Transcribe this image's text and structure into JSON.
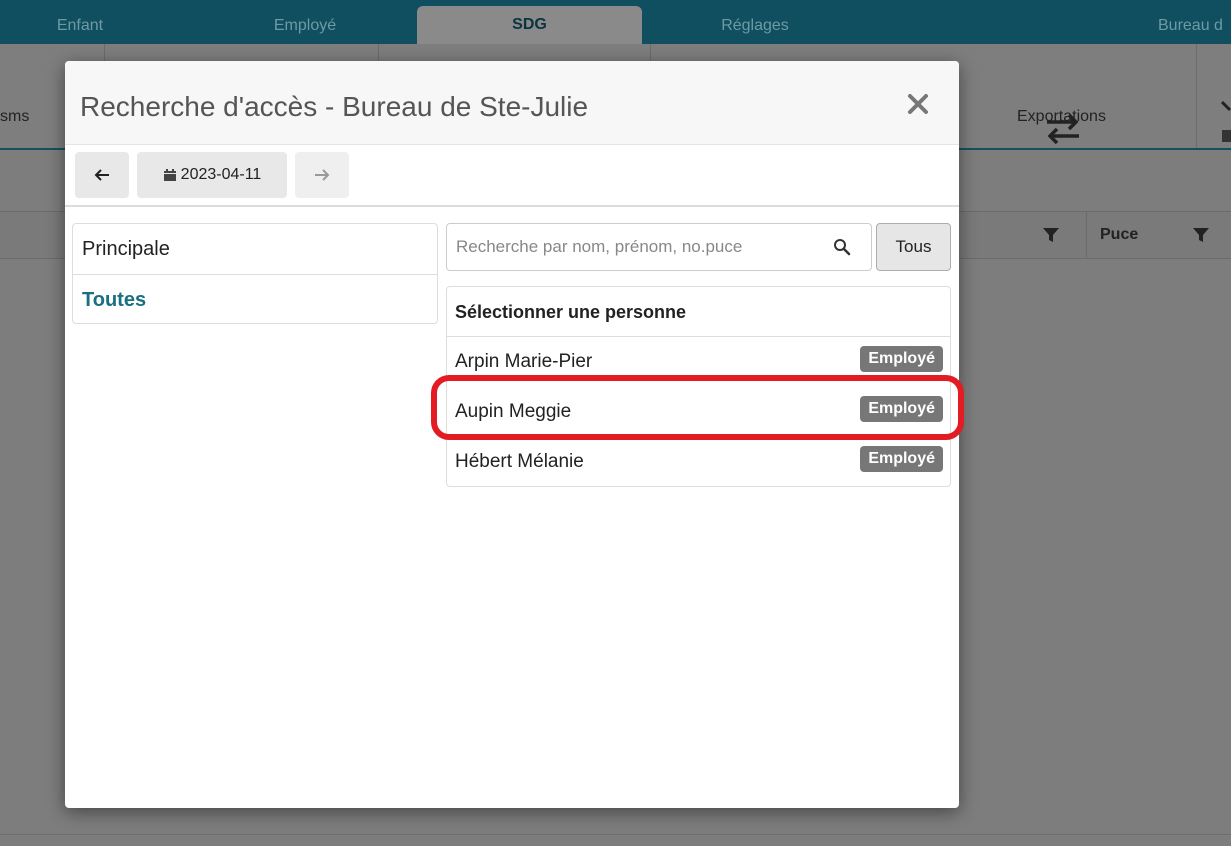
{
  "topnav": {
    "tabs": [
      {
        "label": "Enfant"
      },
      {
        "label": "Employé"
      },
      {
        "label": "SDG"
      },
      {
        "label": "Réglages"
      },
      {
        "label": "Bureau d"
      }
    ]
  },
  "toolbar": {
    "partial_label": "sms",
    "exportations_label": "Exportations"
  },
  "grid": {
    "puce_header": "Puce"
  },
  "modal": {
    "title": "Recherche d'accès - Bureau de Ste-Julie",
    "date": "2023-04-11",
    "left_items": [
      {
        "label": "Principale"
      },
      {
        "label": "Toutes"
      }
    ],
    "search_placeholder": "Recherche par nom, prénom, no.puce",
    "tous_label": "Tous",
    "list_header": "Sélectionner une personne",
    "people": [
      {
        "name": "Arpin Marie-Pier",
        "badge": "Employé"
      },
      {
        "name": "Aupin Meggie",
        "badge": "Employé"
      },
      {
        "name": "Hébert Mélanie",
        "badge": "Employé"
      }
    ]
  },
  "colors": {
    "nav_bg": "#0f4f60",
    "accent": "#1a6f80",
    "highlight": "#e31c23",
    "badge_bg": "#777777"
  }
}
